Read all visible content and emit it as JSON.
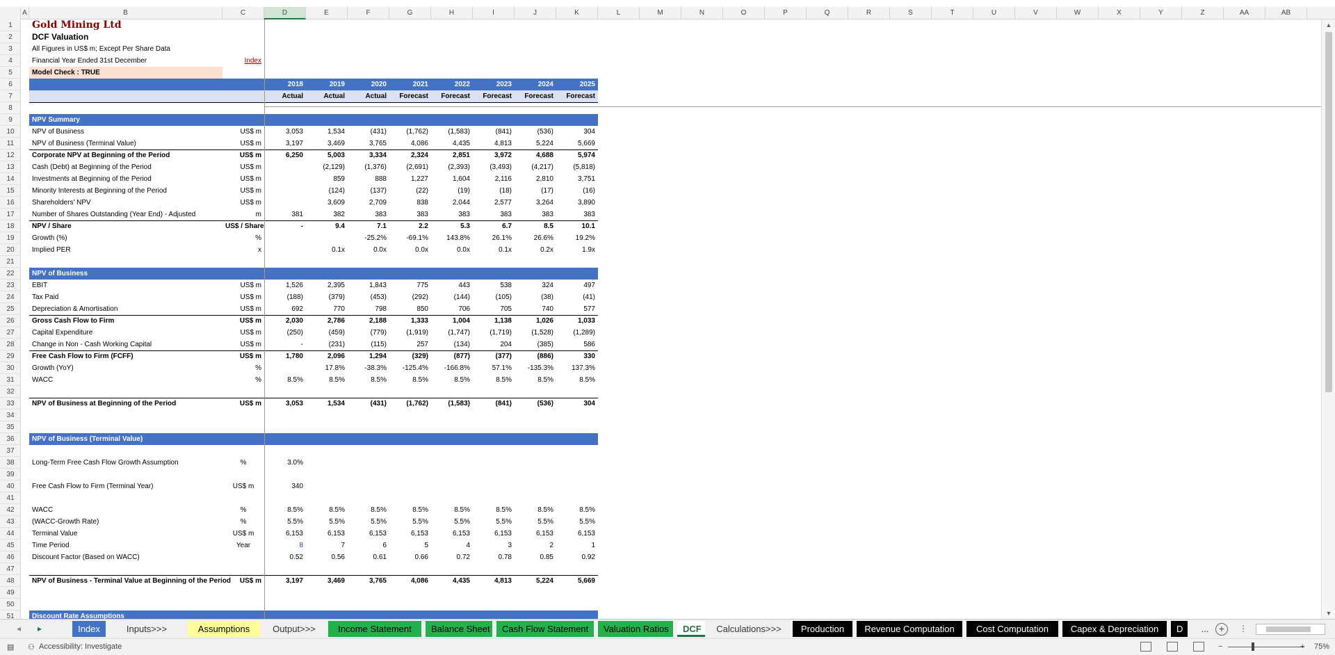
{
  "columns": [
    "A",
    "B",
    "C",
    "D",
    "E",
    "F",
    "G",
    "H",
    "I",
    "J",
    "K",
    "L",
    "M",
    "N",
    "O",
    "P",
    "Q",
    "R",
    "S",
    "T",
    "U",
    "V",
    "W",
    "X",
    "Y",
    "Z",
    "AA",
    "AB"
  ],
  "rows": [
    "1",
    "2",
    "3",
    "4",
    "5",
    "6",
    "7",
    "8",
    "9",
    "10",
    "11",
    "12",
    "13",
    "14",
    "15",
    "16",
    "17",
    "18",
    "19",
    "20",
    "21",
    "22",
    "23",
    "24",
    "25",
    "26",
    "27",
    "28",
    "29",
    "30",
    "31",
    "32",
    "33",
    "34",
    "35",
    "36",
    "37",
    "38",
    "39",
    "40",
    "41",
    "42",
    "43",
    "44",
    "45",
    "46",
    "47",
    "48",
    "49",
    "50",
    "51"
  ],
  "header": {
    "company": "Gold Mining Ltd",
    "subtitle": "DCF Valuation",
    "note1": "All Figures in US$ m; Except Per Share Data",
    "note2": "Financial Year Ended 31st December",
    "index_link": "Index",
    "model_check": "Model Check : TRUE"
  },
  "years": [
    "2018",
    "2019",
    "2020",
    "2021",
    "2022",
    "2023",
    "2024",
    "2025"
  ],
  "periods": [
    "Actual",
    "Actual",
    "Actual",
    "Forecast",
    "Forecast",
    "Forecast",
    "Forecast",
    "Forecast"
  ],
  "sections": {
    "npv_summary": "NPV Summary",
    "npv_business": "NPV of Business",
    "npv_terminal": "NPV of Business (Terminal Value)",
    "discount_rate": "Discount Rate Assumptions"
  },
  "npv_summary_rows": [
    {
      "label": "NPV of Business",
      "unit": "US$ m",
      "bold": false,
      "vals": [
        "3,053",
        "1,534",
        "(431)",
        "(1,762)",
        "(1,583)",
        "(841)",
        "(536)",
        "304"
      ]
    },
    {
      "label": "NPV of Business (Terminal Value)",
      "unit": "US$ m",
      "bold": false,
      "vals": [
        "3,197",
        "3,469",
        "3,765",
        "4,086",
        "4,435",
        "4,813",
        "5,224",
        "5,669"
      ]
    },
    {
      "label": "Corporate NPV at Beginning of the Period",
      "unit": "US$ m",
      "bold": true,
      "vals": [
        "6,250",
        "5,003",
        "3,334",
        "2,324",
        "2,851",
        "3,972",
        "4,688",
        "5,974"
      ]
    },
    {
      "label": "Cash (Debt) at Beginning of the Period",
      "unit": "US$ m",
      "bold": false,
      "vals": [
        "",
        "(2,129)",
        "(1,376)",
        "(2,691)",
        "(2,393)",
        "(3,493)",
        "(4,217)",
        "(5,818)"
      ]
    },
    {
      "label": "Investments at Beginning of the Period",
      "unit": "US$ m",
      "bold": false,
      "vals": [
        "",
        "859",
        "888",
        "1,227",
        "1,604",
        "2,116",
        "2,810",
        "3,751"
      ]
    },
    {
      "label": "Minority Interests at Beginning of the Period",
      "unit": "US$ m",
      "bold": false,
      "vals": [
        "",
        "(124)",
        "(137)",
        "(22)",
        "(19)",
        "(18)",
        "(17)",
        "(16)"
      ]
    },
    {
      "label": "Shareholders' NPV",
      "unit": "US$ m",
      "bold": false,
      "vals": [
        "",
        "3,609",
        "2,709",
        "838",
        "2,044",
        "2,577",
        "3,264",
        "3,890"
      ]
    },
    {
      "label": "Number of Shares Outstanding (Year End) - Adjusted",
      "unit": "m",
      "bold": false,
      "vals": [
        "381",
        "382",
        "383",
        "383",
        "383",
        "383",
        "383",
        "383"
      ]
    },
    {
      "label": "NPV / Share",
      "unit": "US$ / Share",
      "bold": true,
      "vals": [
        "-",
        "9.4",
        "7.1",
        "2.2",
        "5.3",
        "6.7",
        "8.5",
        "10.1"
      ]
    },
    {
      "label": "Growth (%)",
      "unit": "%",
      "bold": false,
      "vals": [
        "",
        "",
        "-25.2%",
        "-69.1%",
        "143.8%",
        "26.1%",
        "26.6%",
        "19.2%"
      ]
    },
    {
      "label": "Implied PER",
      "unit": "x",
      "bold": false,
      "vals": [
        "",
        "0.1x",
        "0.0x",
        "0.0x",
        "0.0x",
        "0.1x",
        "0.2x",
        "1.9x"
      ]
    }
  ],
  "npv_business_rows": [
    {
      "label": "EBIT",
      "unit": "US$ m",
      "bold": false,
      "vals": [
        "1,526",
        "2,395",
        "1,843",
        "775",
        "443",
        "538",
        "324",
        "497"
      ]
    },
    {
      "label": "Tax Paid",
      "unit": "US$ m",
      "bold": false,
      "vals": [
        "(188)",
        "(379)",
        "(453)",
        "(292)",
        "(144)",
        "(105)",
        "(38)",
        "(41)"
      ]
    },
    {
      "label": "Depreciation & Amortisation",
      "unit": "US$ m",
      "bold": false,
      "vals": [
        "692",
        "770",
        "798",
        "850",
        "706",
        "705",
        "740",
        "577"
      ]
    },
    {
      "label": "Gross Cash Flow to Firm",
      "unit": "US$ m",
      "bold": true,
      "vals": [
        "2,030",
        "2,786",
        "2,188",
        "1,333",
        "1,004",
        "1,138",
        "1,026",
        "1,033"
      ]
    },
    {
      "label": "Capital Expenditure",
      "unit": "US$ m",
      "bold": false,
      "vals": [
        "(250)",
        "(459)",
        "(779)",
        "(1,919)",
        "(1,747)",
        "(1,719)",
        "(1,528)",
        "(1,289)"
      ]
    },
    {
      "label": "Change in Non - Cash Working Capital",
      "unit": "US$ m",
      "bold": false,
      "vals": [
        "-",
        "(231)",
        "(115)",
        "257",
        "(134)",
        "204",
        "(385)",
        "586"
      ]
    },
    {
      "label": "Free Cash Flow to Firm (FCFF)",
      "unit": "US$ m",
      "bold": true,
      "vals": [
        "1,780",
        "2,096",
        "1,294",
        "(329)",
        "(877)",
        "(377)",
        "(886)",
        "330"
      ]
    },
    {
      "label": "Growth (YoY)",
      "unit": "%",
      "bold": false,
      "vals": [
        "",
        "17.8%",
        "-38.3%",
        "-125.4%",
        "-166.8%",
        "57.1%",
        "-135.3%",
        "137.3%"
      ]
    },
    {
      "label": "WACC",
      "unit": "%",
      "bold": false,
      "vals": [
        "8.5%",
        "8.5%",
        "8.5%",
        "8.5%",
        "8.5%",
        "8.5%",
        "8.5%",
        "8.5%"
      ]
    }
  ],
  "npv_begin": {
    "label": "NPV of Business at Beginning of the Period",
    "unit": "US$ m",
    "vals": [
      "3,053",
      "1,534",
      "(431)",
      "(1,762)",
      "(1,583)",
      "(841)",
      "(536)",
      "304"
    ]
  },
  "terminal": {
    "ltg_label": "Long-Term Free Cash Flow Growth Assumption",
    "ltg_unit": "%",
    "ltg_val": "3.0%",
    "fcf_label": "Free Cash Flow to Firm (Terminal Year)",
    "fcf_unit": "US$ m",
    "fcf_val": "340"
  },
  "terminal_rows": [
    {
      "label": "WACC",
      "unit": "%",
      "vals": [
        "8.5%",
        "8.5%",
        "8.5%",
        "8.5%",
        "8.5%",
        "8.5%",
        "8.5%",
        "8.5%"
      ]
    },
    {
      "label": "(WACC-Growth Rate)",
      "unit": "%",
      "vals": [
        "5.5%",
        "5.5%",
        "5.5%",
        "5.5%",
        "5.5%",
        "5.5%",
        "5.5%",
        "5.5%"
      ]
    },
    {
      "label": "Terminal Value",
      "unit": "US$ m",
      "vals": [
        "6,153",
        "6,153",
        "6,153",
        "6,153",
        "6,153",
        "6,153",
        "6,153",
        "6,153"
      ]
    },
    {
      "label": "Time Period",
      "unit": "Year",
      "vals": [
        "8",
        "7",
        "6",
        "5",
        "4",
        "3",
        "2",
        "1"
      ]
    },
    {
      "label": "Discount Factor (Based on WACC)",
      "unit": "",
      "vals": [
        "0.52",
        "0.56",
        "0.61",
        "0.66",
        "0.72",
        "0.78",
        "0.85",
        "0.92"
      ]
    }
  ],
  "terminal_total": {
    "label": "NPV of Business - Terminal Value at Beginning of the Period",
    "unit": "US$ m",
    "vals": [
      "3,197",
      "3,469",
      "3,765",
      "4,086",
      "4,435",
      "4,813",
      "5,224",
      "5,669"
    ]
  },
  "tabs": [
    {
      "label": "Index",
      "bg": "#4472c4",
      "fg": "#ffffff"
    },
    {
      "label": "Inputs>>>",
      "bg": "#f0f0f0",
      "fg": "#333333"
    },
    {
      "label": "Assumptions",
      "bg": "#ffff99",
      "fg": "#000000"
    },
    {
      "label": "Output>>>",
      "bg": "#f0f0f0",
      "fg": "#333333"
    },
    {
      "label": "Income Statement",
      "bg": "#22b14c",
      "fg": "#000000"
    },
    {
      "label": "Balance Sheet",
      "bg": "#22b14c",
      "fg": "#000000"
    },
    {
      "label": "Cash Flow Statement",
      "bg": "#22b14c",
      "fg": "#000000"
    },
    {
      "label": "Valuation Ratios",
      "bg": "#22b14c",
      "fg": "#000000"
    },
    {
      "label": "DCF",
      "bg": "#ffffff",
      "fg": "#217346"
    },
    {
      "label": "Calculations>>>",
      "bg": "#f0f0f0",
      "fg": "#333333"
    },
    {
      "label": "Production",
      "bg": "#000000",
      "fg": "#ffffff"
    },
    {
      "label": "Revenue Computation",
      "bg": "#000000",
      "fg": "#ffffff"
    },
    {
      "label": "Cost Computation",
      "bg": "#000000",
      "fg": "#ffffff"
    },
    {
      "label": "Capex & Depreciation",
      "bg": "#000000",
      "fg": "#ffffff"
    },
    {
      "label": "D",
      "bg": "#000000",
      "fg": "#ffffff"
    }
  ],
  "tab_more": "...",
  "status": {
    "accessibility": "Accessibility: Investigate",
    "zoom": "75%"
  }
}
